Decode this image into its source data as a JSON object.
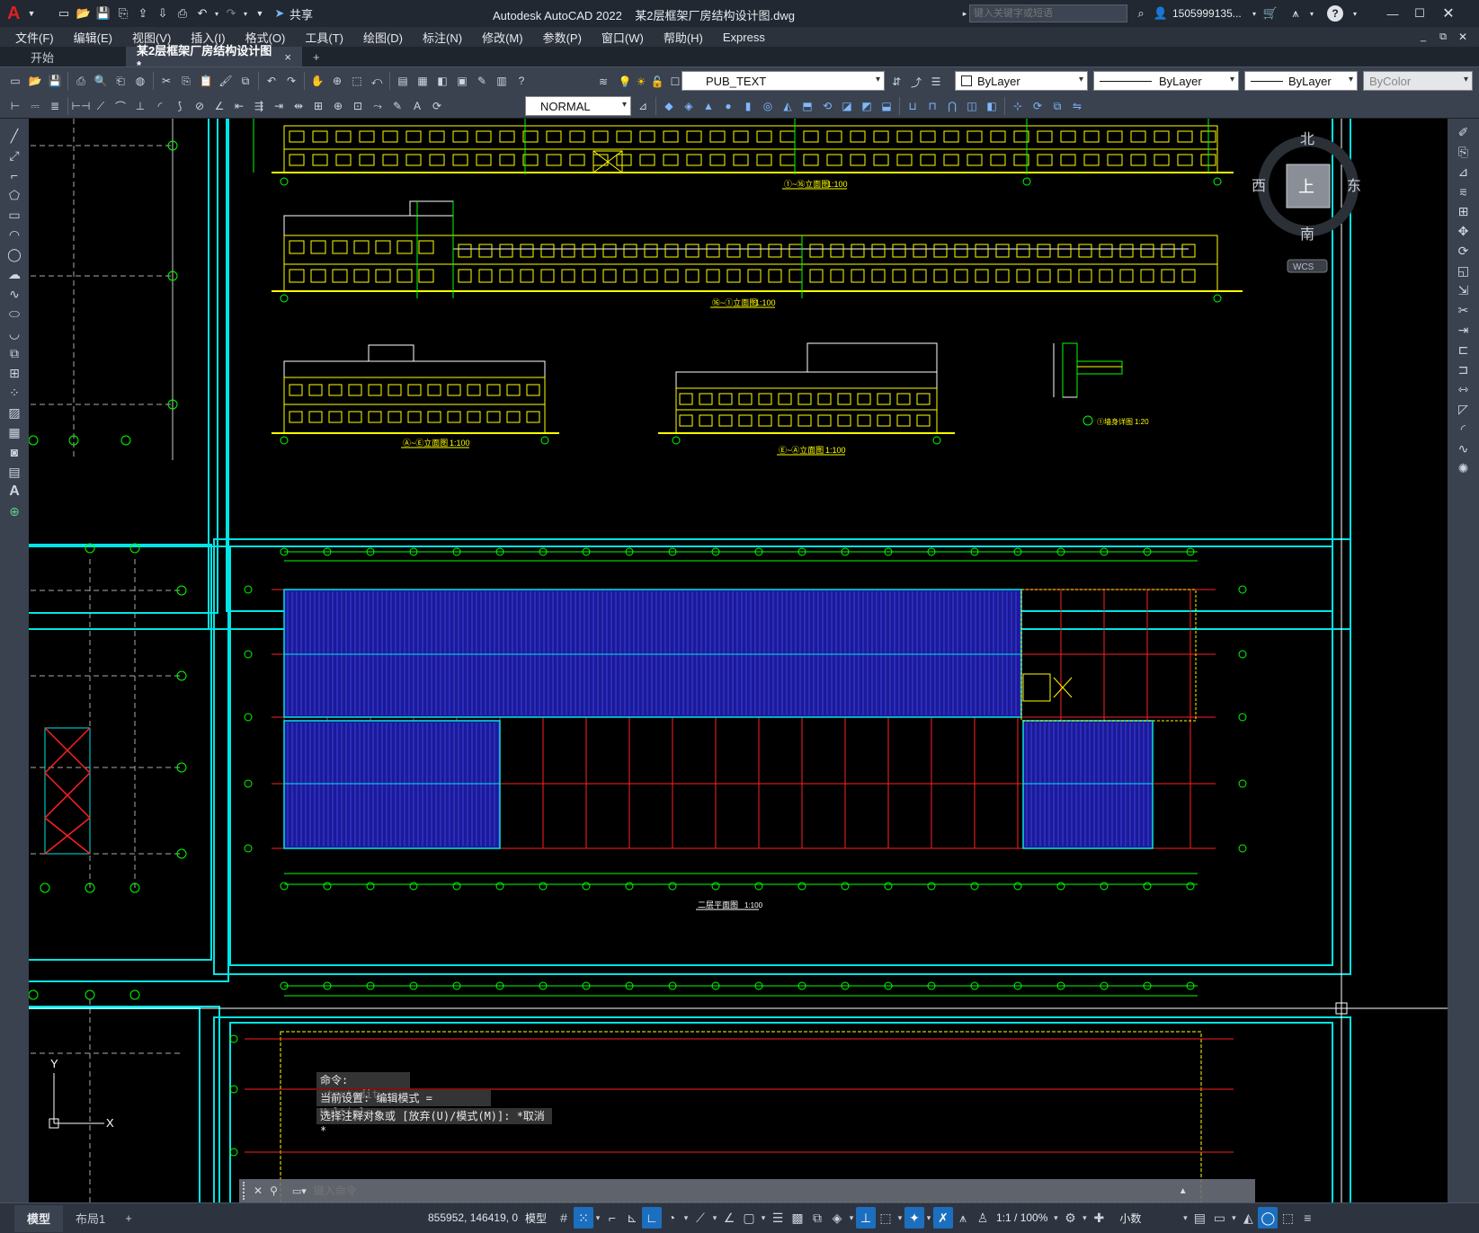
{
  "app": {
    "logo": "A",
    "product": "Autodesk AutoCAD 2022",
    "file": "某2层框架厂房结构设计图.dwg",
    "share_label": "共享",
    "search_placeholder": "键入关键字或短语",
    "user": "1505999135...",
    "help": "?"
  },
  "menu": [
    "文件(F)",
    "编辑(E)",
    "视图(V)",
    "插入(I)",
    "格式(O)",
    "工具(T)",
    "绘图(D)",
    "标注(N)",
    "修改(M)",
    "参数(P)",
    "窗口(W)",
    "帮助(H)",
    "Express"
  ],
  "tabs": {
    "start": "开始",
    "active": "某2层框架厂房结构设计图*",
    "close": "×",
    "add": "+"
  },
  "toolbar": {
    "layer": "PUB_TEXT",
    "color": "ByLayer",
    "linetype": "ByLayer",
    "lineweight": "ByLayer",
    "plotstyle": "ByColor",
    "textstyle": "NORMAL"
  },
  "viewcube": {
    "north": "北",
    "south": "南",
    "east": "东",
    "west": "西",
    "face": "上",
    "wcs": "WCS"
  },
  "ucs": {
    "y": "Y",
    "x": "X"
  },
  "drawing": {
    "elev1": "①~⑯立面图",
    "elev2": "⑯~①立面图",
    "elev3": "Ⓐ~Ⓔ立面图",
    "elev4": "Ⓔ~Ⓐ立面图",
    "detail": "①墙身详图",
    "detail_scale": "1:20",
    "scale": "1:100",
    "plan": "二层平面图"
  },
  "command": {
    "line1": "命令: _textedit",
    "line2": "当前设置: 编辑模式 = Multiple",
    "line3": "选择注释对象或 [放弃(U)/模式(M)]: *取消*",
    "placeholder": "键入命令"
  },
  "status": {
    "model_tab": "模型",
    "layout_tab": "布局1",
    "add": "+",
    "coords": "855952, 146419, 0",
    "model_btn": "模型",
    "scale": "1:1 / 100%",
    "units": "小数"
  },
  "colors": {
    "accent": "#1c6fbf",
    "yellow": "#ffff00",
    "green": "#00ff00",
    "cyan": "#00e5e5",
    "red": "#ff2020",
    "blue": "#1a1a9a"
  }
}
